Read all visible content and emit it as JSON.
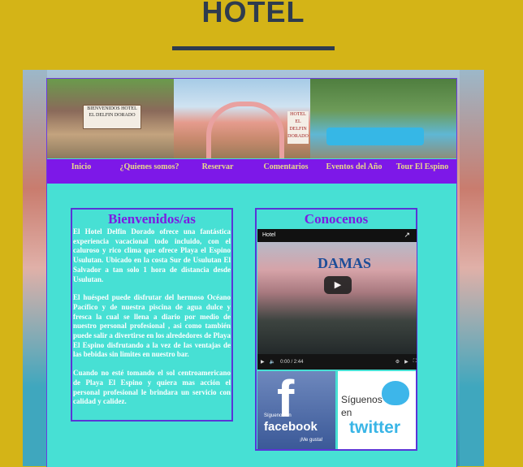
{
  "header": {
    "title": "HOTEL"
  },
  "banner": {
    "sign1": "BIENVENIDOS HOTEL EL DELFIN DORADO",
    "sign2": "HOTEL EL DELFIN DORADO"
  },
  "nav": {
    "items": [
      {
        "label": "Inicio"
      },
      {
        "label": "¿Quienes somos?"
      },
      {
        "label": "Reservar"
      },
      {
        "label": "Comentarios"
      },
      {
        "label": "Eventos del Año"
      },
      {
        "label": "Tour El Espino"
      }
    ]
  },
  "welcome": {
    "title": "Bienvenidos/as",
    "paragraphs": [
      "El Hotel Delfin Dorado ofrece una fantástica experiencia vacacional todo incluido, con el caluroso y rico clima que ofrece Playa el Espino Usulutan. Ubicado en la costa Sur de Usulutan El Salvador a tan solo 1 hora de distancia desde Usulutan.",
      "El huésped puede disfrutar del hermoso Océano Pacífico y de nuestra piscina de agua dulce y fresca la cual se llena a diario por medio de nuestro personal profesional , asi como también puede salir a divertirse en los alrededores de Playa El Espino disfrutando a la vez de las ventajas de las bebidas sin limites en nuestro bar.",
      "Cuando no esté tomando el sol centroamericano de Playa El Espino y quiera mas acción el personal profesional le brindara un servicio con calidad y calidez."
    ]
  },
  "connect": {
    "title": "Conocenos",
    "video": {
      "title": "Hotel",
      "sign": "DAMAS",
      "time": "0:00 / 2:44"
    },
    "facebook": {
      "line1": "Síguenos en",
      "brand": "facebook",
      "like": "¡Me gusta!"
    },
    "twitter": {
      "line1": "Síguenos",
      "line2": "en",
      "brand": "twitter"
    }
  },
  "colors": {
    "background": "#d4b417",
    "accent": "#7c1de2",
    "panel": "#47e0d4",
    "nav_text": "#e9d98b"
  }
}
